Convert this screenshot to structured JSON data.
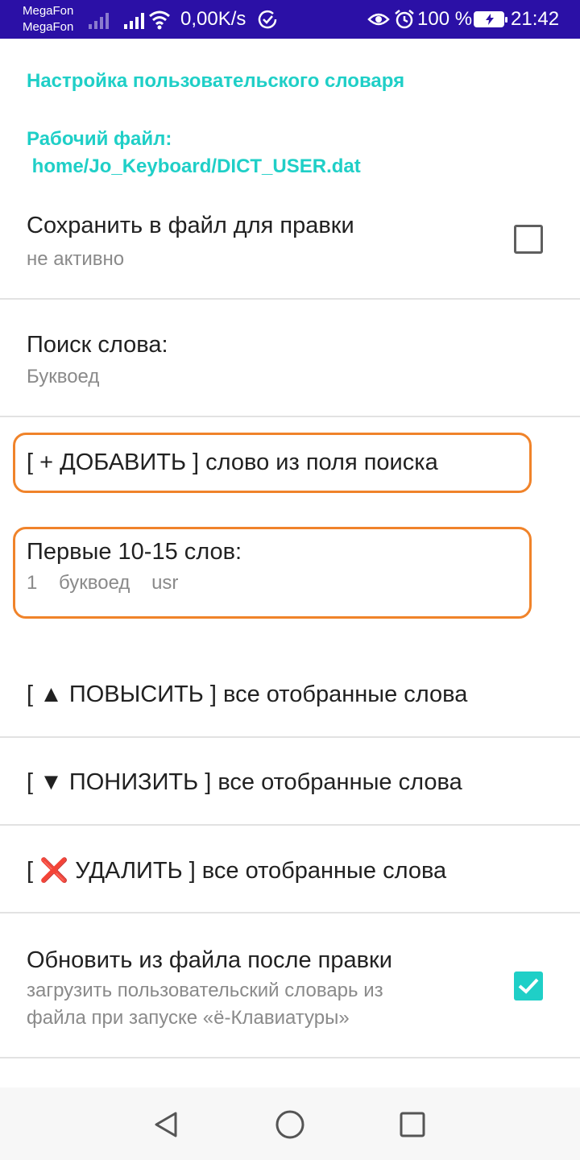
{
  "status_bar": {
    "carrier_1": "MegaFon",
    "carrier_2": "MegaFon",
    "net_speed": "0,00K/s",
    "battery_percent": "100 %",
    "time": "21:42",
    "icons": [
      "signal-weak-icon",
      "signal-full-icon",
      "wifi-icon",
      "sync-check-icon",
      "eye-icon",
      "alarm-icon",
      "battery-charging-icon"
    ]
  },
  "settings": {
    "category_title": "Настройка пользовательского словаря",
    "working_file_label": "Рабочий файл:",
    "working_file_path": " home/Jo_Keyboard/DICT_USER.dat",
    "save_to_file": {
      "title": "Сохранить в файл для правки",
      "summary": "не активно",
      "checked": false
    },
    "search_word": {
      "title": "Поиск слова:",
      "summary": "Буквоед"
    },
    "add_word": {
      "title": "[ + ДОБАВИТЬ ] слово из поля поиска"
    },
    "first_words": {
      "title": "Первые 10-15 слов:",
      "summary": "1    буквоед    usr"
    },
    "raise": {
      "title": "[ ▲ ПОВЫСИТЬ ] все отобранные слова"
    },
    "lower": {
      "title": "[ ▼ ПОНИЗИТЬ ] все отобранные слова"
    },
    "delete": {
      "title": "[ ❌ УДАЛИТЬ ] все отобранные слова"
    },
    "refresh_from_file": {
      "title": "Обновить из файла после правки",
      "summary_line_1": "загрузить пользовательский словарь из",
      "summary_line_2": "файла при запуске «ё-Клавиатуры»",
      "checked": true
    }
  },
  "colors": {
    "status_bar": "#2b10a6",
    "accent": "#1fcfc7",
    "highlight_border": "#f0832a",
    "summary_text": "#8a8a8a"
  },
  "nav_bar": {
    "icons": [
      "back-icon",
      "home-icon",
      "recents-icon"
    ]
  }
}
